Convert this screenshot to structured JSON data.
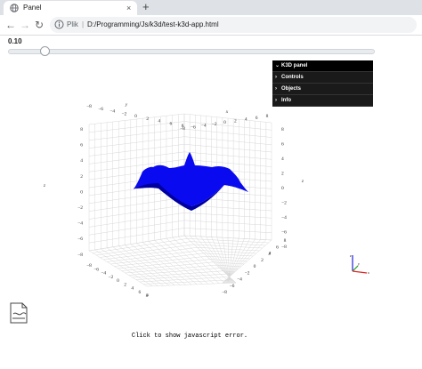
{
  "browser": {
    "tab_title": "Panel",
    "tab_close": "×",
    "new_tab": "+",
    "back": "←",
    "forward": "→",
    "reload": "↻",
    "scheme_label": "Plik",
    "separator": "|",
    "address_path": "D:/Programming/Js/k3d/test-k3d-app.html"
  },
  "slider": {
    "value_label": "0.10",
    "value": 0.1
  },
  "k3d_panel": {
    "title": "K3D panel",
    "items": [
      "Controls",
      "Objects",
      "Info"
    ]
  },
  "axes": {
    "x_label": "x",
    "y_label": "y",
    "z_label": "z",
    "left_z_ticks": [
      "8",
      "6",
      "4",
      "2",
      "0",
      "−2",
      "−4",
      "−6",
      "−8"
    ],
    "right_z_ticks": [
      "8",
      "6",
      "4",
      "2",
      "0",
      "−2",
      "−4",
      "−6",
      "−8"
    ],
    "top_y_ticks": [
      "−8",
      "−6",
      "−4",
      "−2",
      "0",
      "2",
      "4",
      "6",
      "8"
    ],
    "top_x_ticks": [
      "−8",
      "−6",
      "−4",
      "−2",
      "0",
      "2",
      "4",
      "6",
      "8"
    ],
    "bottom_x_ticks": [
      "−8",
      "−6",
      "−4",
      "−2",
      "0",
      "2",
      "4",
      "6",
      "8"
    ],
    "bottom_y_ticks": [
      "−8",
      "−6",
      "−4",
      "−2",
      "0",
      "2",
      "4",
      "6",
      "8"
    ]
  },
  "colors": {
    "surface": "#0a0af0",
    "surface_dark": "#0000a0",
    "grid": "#d8d8d8",
    "axis_x": "#e02020",
    "axis_y": "#20a020",
    "axis_z": "#2020e0"
  },
  "icons": {
    "globe": "globe-icon",
    "info": "info-icon",
    "file": "file-icon"
  },
  "footer": {
    "error_link": "Click to show javascript error."
  }
}
